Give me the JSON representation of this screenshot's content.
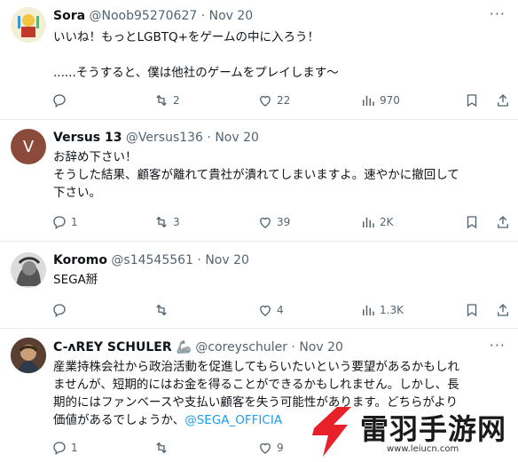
{
  "tweets": [
    {
      "name": "Sora",
      "handle": "@Noob95270627",
      "date": "Nov 20",
      "lines": [
        "いいね！もっとLGBTQ+をゲームの中に入ろう！",
        "",
        "......そうすると、僕は他社のゲームをプレイします〜"
      ],
      "replies": "",
      "retweets": "2",
      "likes": "22",
      "views": "970"
    },
    {
      "name": "Versus 13",
      "handle": "@Versus136",
      "date": "Nov 20",
      "avatar_letter": "V",
      "lines": [
        "お辞め下さい！",
        "そうした結果、顧客が離れて貴社が潰れてしまいますよ。速やかに撤回して",
        "下さい。"
      ],
      "replies": "1",
      "retweets": "3",
      "likes": "39",
      "views": "2K"
    },
    {
      "name": "Koromo",
      "handle": "@s14545561",
      "date": "Nov 20",
      "lines": [
        "SEGA掰"
      ],
      "replies": "",
      "retweets": "",
      "likes": "4",
      "views": "1.3K"
    },
    {
      "name": "C-ᴧREY SCHULER 🦾",
      "handle": "@coreyschuler",
      "date": "Nov 20",
      "lines": [
        "産業持株会社から政治活動を促進してもらいたいという要望があるかもしれ",
        "ませんが、短期的にはお金を得ることができるかもしれません。しかし、長",
        "期的にはファンベースや支払い顧客を失う可能性があります。どちらがより"
      ],
      "last_line_text": "価値があるでしょうか、",
      "last_line_link": "@SEGA_OFFICIA",
      "replies": "1",
      "retweets": "",
      "likes": "9",
      "views": ""
    }
  ],
  "watermark": {
    "brand": "雷羽手游网",
    "url": "www.leiucn.com"
  },
  "colors": {
    "text": "#0f1419",
    "muted": "#536471",
    "link": "#1d9bf0",
    "brand_red": "#e8202a"
  }
}
